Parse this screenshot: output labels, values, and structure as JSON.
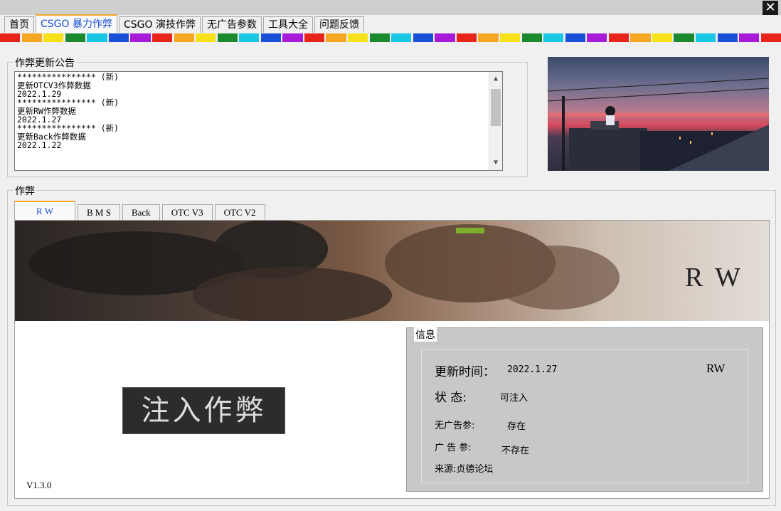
{
  "window": {
    "close_glyph": "✕"
  },
  "main_tabs": [
    "首页",
    "CSGO 暴力作弊",
    "CSGO 演技作弊",
    "无广告参数",
    "工具大全",
    "问题反馈"
  ],
  "rainbow": [
    "#e8241a",
    "#f5a623",
    "#f6e21b",
    "#1b8a2e",
    "#19c6e6",
    "#1a4fd8",
    "#a61ad8",
    "#e8241a",
    "#f5a623",
    "#f6e21b",
    "#1b8a2e",
    "#19c6e6",
    "#1a4fd8",
    "#a61ad8",
    "#e8241a",
    "#f5a623",
    "#f6e21b",
    "#1b8a2e",
    "#19c6e6",
    "#1a4fd8",
    "#a61ad8",
    "#e8241a",
    "#f5a623",
    "#f6e21b",
    "#1b8a2e",
    "#19c6e6",
    "#1a4fd8",
    "#a61ad8",
    "#e8241a",
    "#f5a623",
    "#f6e21b",
    "#1b8a2e",
    "#19c6e6",
    "#1a4fd8",
    "#a61ad8",
    "#e8241a"
  ],
  "notice": {
    "title": "作弊更新公告",
    "lines": [
      "**************** (新)",
      "更新OTCV3作弊数据",
      "2022.1.29",
      "**************** (新)",
      "更新RW作弊数据",
      "2022.1.27",
      "**************** (新)",
      "更新Back作弊数据",
      "2022.1.22"
    ]
  },
  "cheat": {
    "title": "作弊",
    "tabs": [
      "R W",
      "B M S",
      "Back",
      "OTC V3",
      "OTC V2"
    ],
    "banner_title": "R W",
    "inject_label": "注入作弊",
    "version": "V1.3.0",
    "info": {
      "title": "信息",
      "update_label": "更新时间：",
      "update_value": "2022.1.27",
      "name": "RW",
      "status_label": "状 态:",
      "status_value": "可注入",
      "noad_label": "无广告参:",
      "noad_value": "存在",
      "ad_label": "广 告 参:",
      "ad_value": "不存在",
      "source": "来源:贞德论坛"
    }
  },
  "scroll": {
    "up": "▲",
    "down": "▼"
  }
}
